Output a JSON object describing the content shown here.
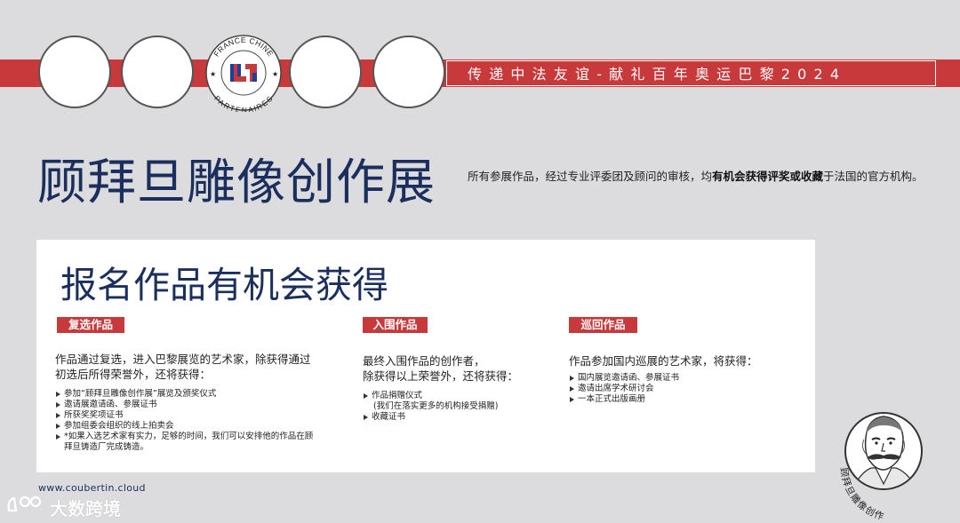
{
  "banner": {
    "text": "传递中法友谊-献礼百年奥运巴黎2024"
  },
  "logo": {
    "top_text": "FRANCE CHINE",
    "bottom_text": "PARTENAIRES",
    "colors": {
      "red": "#c8393b",
      "blue": "#1f3fa0"
    }
  },
  "header": {
    "title": "顾拜旦雕像创作展",
    "intro_prefix": "所有参展作品，经过专业评委团及顾问的审核，均",
    "intro_bold": "有机会获得评奖或收藏",
    "intro_suffix": "于法国的官方机构。"
  },
  "card": {
    "title": "报名作品有机会获得",
    "columns": [
      {
        "tag": "复选作品",
        "para_lines": [
          "作品通过复选，进入巴黎展览的艺术家，除获得通过",
          "初选后所得荣誉外，还将获得："
        ],
        "bullets": [
          "参加“顾拜旦雕像创作展”展览及颁奖仪式",
          "邀请展邀请函、参展证书",
          "所获奖奖项证书",
          "参加组委会组织的线上拍卖会",
          "*如果入选艺术家有实力，足够的时间，我们可以安排他的作品在顾",
          "拜旦铸造厂完成铸造。"
        ]
      },
      {
        "tag": "入围作品",
        "para_lines": [
          "最终入围作品的创作者，",
          "除获得以上荣誉外，还将获得："
        ],
        "bullets": [
          "作品捐赠仪式",
          "(我们在落实更多的机构接受捐赠)",
          "收藏证书"
        ]
      },
      {
        "tag": "巡回作品",
        "para_lines": [
          "作品参加国内巡展的艺术家，将获得："
        ],
        "bullets": [
          "国内展览邀请函、参展证书",
          "邀请出席学术研讨会",
          "一本正式出版画册"
        ]
      }
    ]
  },
  "footer": {
    "website": "www.coubertin.cloud",
    "watermark": "大数跨境",
    "portrait_caption": "顾拜旦雕像创作"
  },
  "colors": {
    "accent_red": "#c8393b",
    "navy": "#1a2f5e",
    "background": "#dcdcde"
  }
}
